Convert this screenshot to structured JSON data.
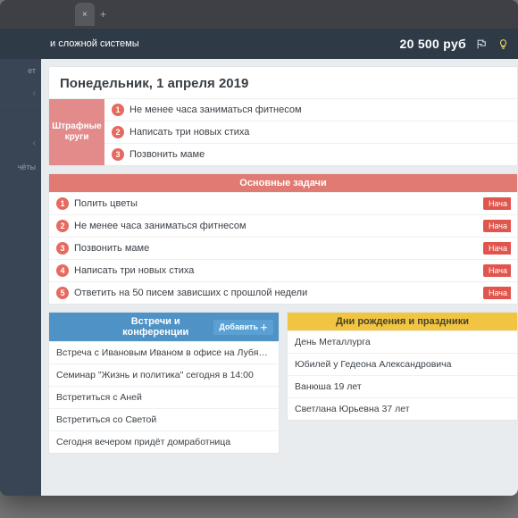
{
  "browser": {
    "close_hint": "×",
    "new_tab_hint": "+"
  },
  "topbar": {
    "breadcrumb": "и сложной системы",
    "balance": "20 500 руб"
  },
  "sidebar": {
    "items": [
      {
        "label": "ет"
      },
      {
        "label": ""
      },
      {
        "label": ""
      },
      {
        "label": "чёты"
      }
    ]
  },
  "page": {
    "title": "Понедельник, 1 апреля 2019"
  },
  "penalty": {
    "badge": "Штрафные круги",
    "items": [
      {
        "n": "1",
        "text": "Не менее часа заниматься фитнесом"
      },
      {
        "n": "2",
        "text": "Написать три новых стиха"
      },
      {
        "n": "3",
        "text": "Позвонить маме"
      }
    ]
  },
  "main_tasks": {
    "title": "Основные задачи",
    "start_label": "Нача",
    "items": [
      {
        "n": "1",
        "text": "Полить цветы"
      },
      {
        "n": "2",
        "text": "Не менее часа заниматься фитнесом"
      },
      {
        "n": "3",
        "text": "Позвонить маме"
      },
      {
        "n": "4",
        "text": "Написать три новых стиха"
      },
      {
        "n": "5",
        "text": "Ответить на 50 писем зависших с прошлой недели"
      }
    ]
  },
  "meetings": {
    "title": "Встречи и конференции",
    "add_label": "Добавить",
    "items": [
      "Встреча с Ивановым Иваном в офисе на Лубянке",
      "Семинар \"Жизнь и политика\" сегодня в 14:00",
      "Встретиться с Аней",
      "Встретиться со Светой",
      "Сегодня вечером придёт домработница"
    ]
  },
  "birthdays": {
    "title": "Дни рождения и праздники",
    "items": [
      "День Металлурга",
      "Юбилей у Гедеона Александровича",
      "Ванюша 19 лет",
      "Светлана Юрьевна 37 лет"
    ]
  }
}
